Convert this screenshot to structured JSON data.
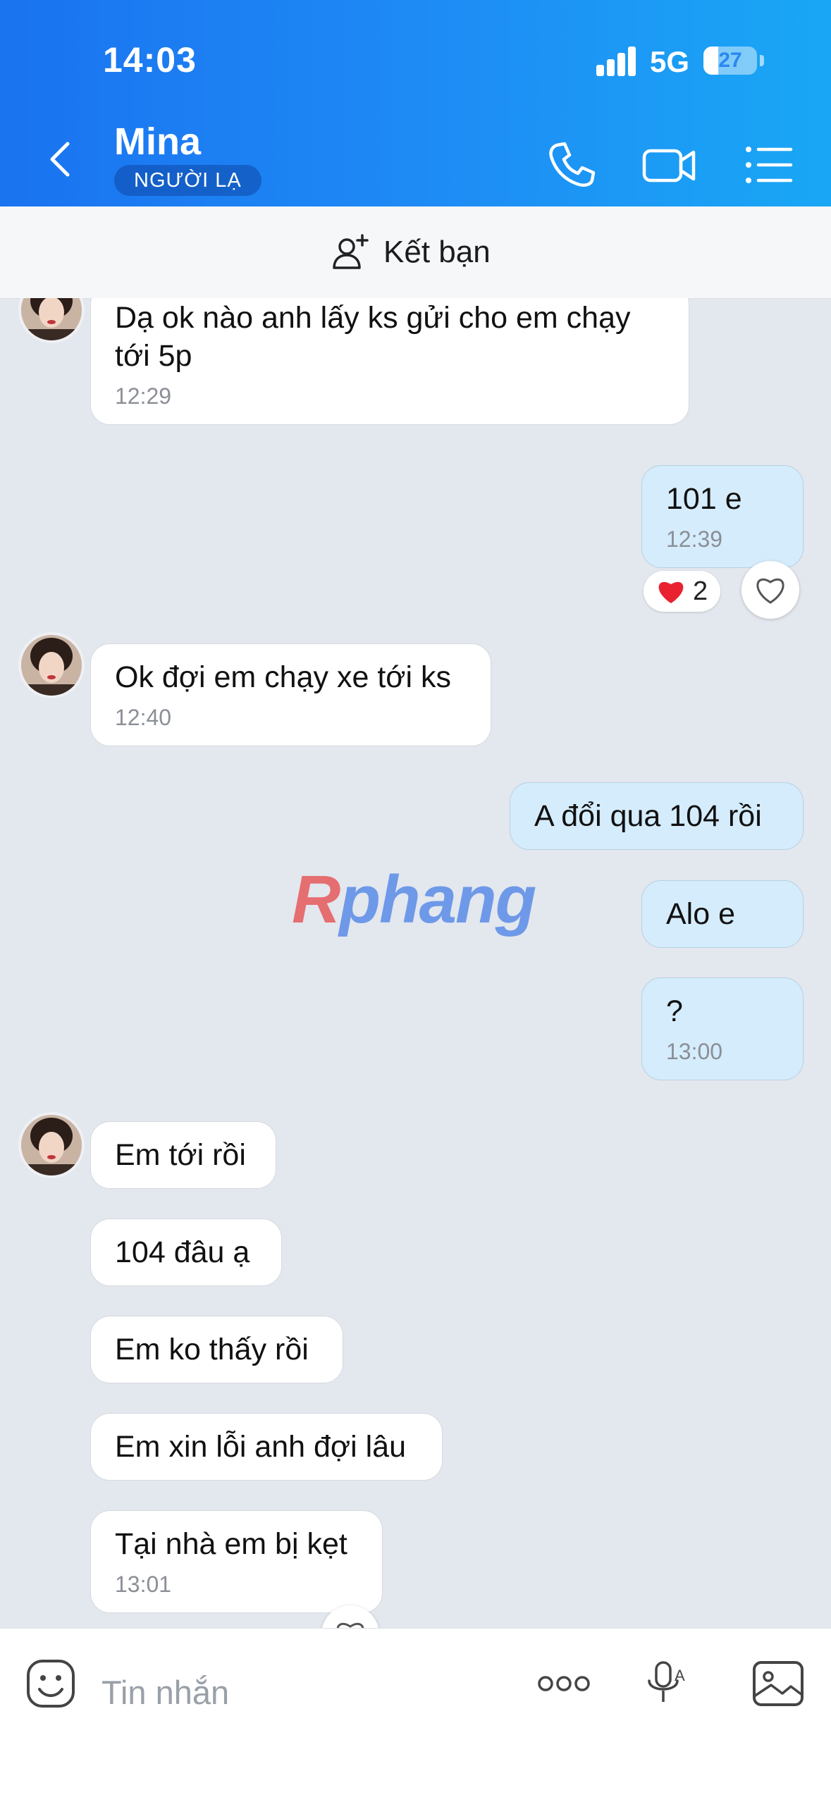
{
  "status_bar": {
    "time": "14:03",
    "network": "5G",
    "battery": "27",
    "battery_level": 0.27
  },
  "header": {
    "contact_name": "Mina",
    "stranger_badge": "NGƯỜI LẠ"
  },
  "friend_bar": {
    "add_friend_label": "Kết bạn"
  },
  "messages": [
    {
      "side": "in",
      "text_line1": "Dạ ok nào anh lấy ks gửi cho em chạy",
      "text_line2": "tới 5p",
      "time": "12:29"
    },
    {
      "side": "out",
      "text": "101 e",
      "time": "12:39",
      "reaction_count": "2"
    },
    {
      "side": "in",
      "text": "Ok đợi em chạy xe tới ks",
      "time": "12:40"
    },
    {
      "side": "out",
      "text": "A đổi qua 104 rồi"
    },
    {
      "side": "out",
      "text": "Alo e"
    },
    {
      "side": "out",
      "text": "?",
      "time": "13:00"
    },
    {
      "side": "in",
      "text": "Em tới rồi"
    },
    {
      "side": "in",
      "text": "104 đâu ạ"
    },
    {
      "side": "in",
      "text": "Em ko thấy rồi"
    },
    {
      "side": "in",
      "text": "Em xin lỗi anh đợi lâu"
    },
    {
      "side": "in",
      "text": "Tại nhà em bị kẹt",
      "time": "13:01"
    }
  ],
  "watermark": {
    "part1": "R",
    "part2": "phang"
  },
  "input_bar": {
    "placeholder": "Tin nhắn"
  },
  "colors": {
    "header_start": "#1a73f0",
    "header_end": "#19a7f5",
    "outgoing_bubble": "#d5ecfc",
    "incoming_bubble": "#ffffff",
    "chat_bg": "#e3e7ee"
  }
}
